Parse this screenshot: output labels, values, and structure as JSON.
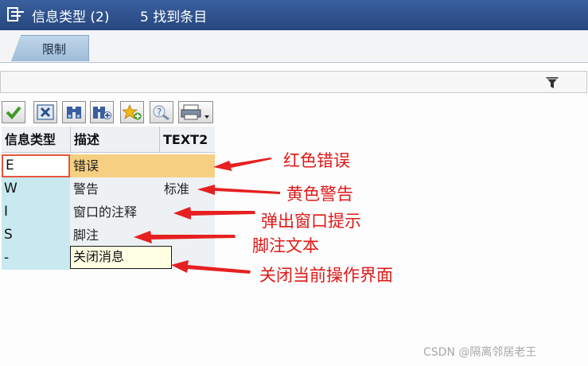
{
  "window": {
    "title": "信息类型 (2)",
    "count": "5 找到条目",
    "icon": "dialog-icon"
  },
  "tabs": [
    {
      "label": "限制"
    }
  ],
  "filterbar": {
    "icon": "filter-icon"
  },
  "toolbar": {
    "buttons": [
      {
        "icon": "checkmark-icon"
      },
      {
        "icon": "cancel-icon"
      },
      {
        "icon": "binoculars-find-icon"
      },
      {
        "icon": "find-next-icon"
      },
      {
        "icon": "favorite-add-icon"
      },
      {
        "icon": "help-info-icon"
      },
      {
        "icon": "print-dropdown-icon"
      }
    ]
  },
  "table": {
    "columns": [
      "信息类型",
      "描述",
      "TEXT2"
    ],
    "rows": [
      {
        "type": "E",
        "desc": "错误",
        "text2": ""
      },
      {
        "type": "W",
        "desc": "警告",
        "text2": "标准"
      },
      {
        "type": "I",
        "desc": "窗口的注释",
        "text2": ""
      },
      {
        "type": "S",
        "desc": "脚注",
        "text2": ""
      },
      {
        "type": "-",
        "desc": "",
        "text2": ""
      }
    ],
    "tooltip": "关闭消息"
  },
  "annotations": [
    {
      "text": "红色错误"
    },
    {
      "text": "黄色警告"
    },
    {
      "text": "弹出窗口提示"
    },
    {
      "text": "脚注文本"
    },
    {
      "text": "关闭当前操作界面"
    }
  ],
  "colors": {
    "annotation": "#e01818",
    "titlebar": "#2f528f",
    "selected_row": "#f7cf82"
  },
  "watermark": "CSDN @隔离邻居老王"
}
